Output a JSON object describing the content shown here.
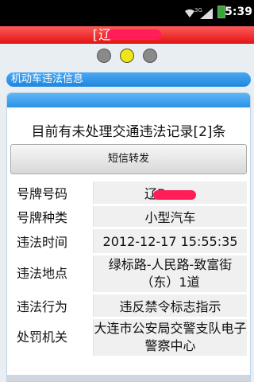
{
  "status_bar": {
    "time": "5:39",
    "network": "3G",
    "icons": [
      "wifi-icon",
      "signal-icon",
      "battery-icon"
    ]
  },
  "app": {
    "title": "[辽B",
    "accent_red": "#e11313",
    "accent_blue": "#1e86de"
  },
  "pager": {
    "count": 3,
    "active_index": 1
  },
  "section": {
    "title": "机动车违法信息"
  },
  "card": {
    "notice": "目前有未处理交通违法记录[2]条",
    "sms_button": "短信转发",
    "fields": [
      {
        "label": "号牌号码",
        "value": "辽B"
      },
      {
        "label": "号牌种类",
        "value": "小型汽车"
      },
      {
        "label": "违法时间",
        "value": "2012-12-17 15:55:35"
      },
      {
        "label": "违法地点",
        "value": "绿标路-人民路-致富街（东）1道"
      },
      {
        "label": "违法行为",
        "value": "违反禁令标志指示"
      },
      {
        "label": "处罚机关",
        "value": "大连市公安局交警支队电子警察中心"
      }
    ]
  }
}
